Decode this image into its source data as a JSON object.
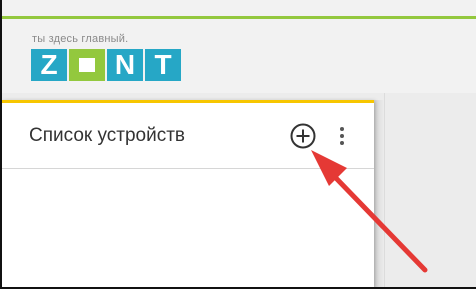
{
  "header": {
    "logo": {
      "tagline": "ты здесь главный.",
      "letters": [
        "Z",
        "O",
        "N",
        "T"
      ],
      "colors": {
        "blue": "#26a7c6",
        "green": "#93c83e"
      }
    },
    "accent_color": "#93c83e"
  },
  "device_panel": {
    "title": "Список устройств",
    "accent_color": "#f7c600",
    "add_button_icon": "plus-circle-icon",
    "more_button_icon": "vertical-dots-icon"
  },
  "annotation": {
    "arrow_color": "#e53935"
  }
}
